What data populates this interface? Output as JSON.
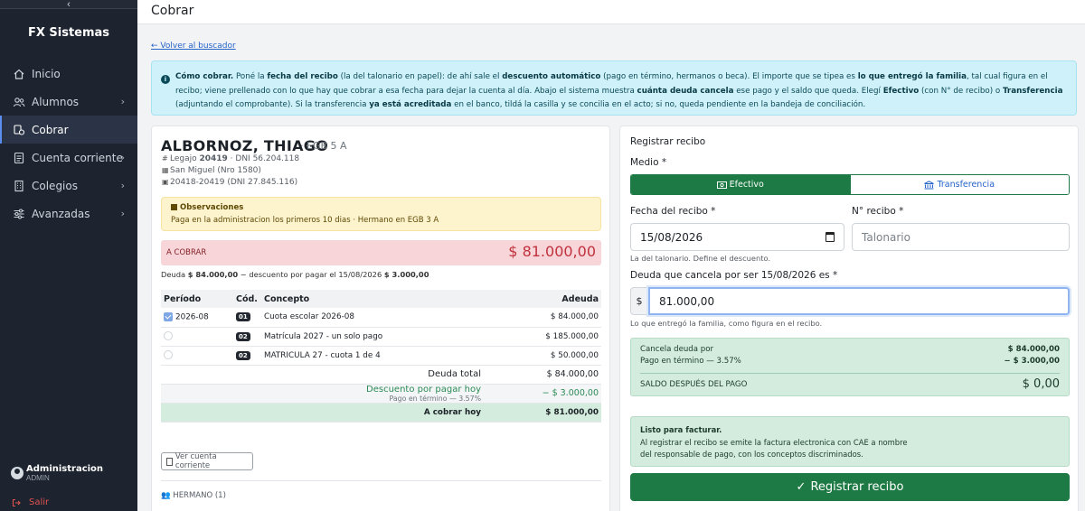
{
  "sidebar": {
    "collapse_glyph": "‹",
    "brand": "FX Sistemas",
    "items": [
      {
        "label": "Inicio"
      },
      {
        "label": "Alumnos"
      },
      {
        "label": "Cobrar"
      },
      {
        "label": "Cuenta corriente"
      },
      {
        "label": "Colegios"
      },
      {
        "label": "Avanzadas"
      }
    ],
    "user": {
      "name": "Administracion",
      "role": "ADMIN"
    },
    "logout": "Salir"
  },
  "topbar": {
    "title": "Cobrar"
  },
  "back_link": "← Volver al buscador",
  "info": {
    "p1": "Cómo cobrar.",
    "p2": " Poné la ",
    "p3": "fecha del recibo",
    "p4": " (la del talonario en papel): de ahí sale el ",
    "p5": "descuento automático",
    "p6": " (pago en término, hermanos o beca). El importe que se tipea es ",
    "p7": "lo que entregó la familia",
    "p8": ", tal cual figura en el recibo; viene prellenado con lo que hay que cobrar a esa fecha para dejar la cuenta al día. Abajo el sistema muestra ",
    "p9": "cuánta deuda cancela",
    "p10": " ese pago y el saldo que queda. Elegí ",
    "p11": "Efectivo",
    "p12": " (con N° de recibo) o ",
    "p13": "Transferencia",
    "p14": " (adjuntando el comprobante). Si la transferencia ",
    "p15": "ya está acreditada",
    "p16": " en el banco, tildá la casilla y se concilia en el acto; si no, queda pendiente en la bandeja de conciliación."
  },
  "student": {
    "name": "ALBORNOZ, THIAGO",
    "grade": "· EGB 5 A",
    "legajo_prefix": "Legajo ",
    "legajo": "20419",
    "dni": " · DNI 56.204.118",
    "school": "San Miguel (Nro 1580)",
    "family": "20418-20419 (DNI 27.845.116)"
  },
  "observaciones": {
    "title": "Observaciones",
    "text": "Paga en la administracion los primeros 10 dias · Hermano en EGB 3 A"
  },
  "a_cobrar": {
    "label": "A COBRAR",
    "value": "$ 81.000,00"
  },
  "deuda_line": {
    "pre": "Deuda ",
    "deuda": "$ 84.000,00",
    "mid": " − descuento por pagar el 15/08/2026 ",
    "desc": "$ 3.000,00"
  },
  "table": {
    "headers": {
      "periodo": "Período",
      "cod": "Cód.",
      "concepto": "Concepto",
      "adeuda": "Adeuda"
    },
    "rows": [
      {
        "periodo": "2026-08",
        "cod": "01",
        "concepto": "Cuota escolar 2026-08",
        "adeuda": "$ 84.000,00"
      },
      {
        "periodo": "",
        "cod": "02",
        "concepto": "Matrícula 2027 - un solo pago",
        "adeuda": "$ 185.000,00"
      },
      {
        "periodo": "",
        "cod": "02",
        "concepto": "MATRICULA 27 - cuota 1 de 4",
        "adeuda": "$ 50.000,00"
      }
    ],
    "deuda_total_label": "Deuda total",
    "deuda_total_value": "$ 84.000,00",
    "descuento_label": "Descuento por pagar hoy",
    "descuento_sub": "Pago en término — 3.57%",
    "descuento_value": "− $ 3.000,00",
    "a_cobrar_hoy_label": "A cobrar hoy",
    "a_cobrar_hoy_value": "$ 81.000,00"
  },
  "ver_cuenta_btn": "Ver cuenta corriente",
  "hermano": "HERMANO (1)",
  "form": {
    "title": "Registrar recibo",
    "medio_label": "Medio *",
    "medio_efectivo": "Efectivo",
    "medio_transferencia": "Transferencia",
    "fecha_label": "Fecha del recibo *",
    "fecha_value": "15/08/2026",
    "fecha_help": "La del talonario. Define el descuento.",
    "nro_label": "N° recibo *",
    "nro_placeholder": "Talonario",
    "deuda_label": "Deuda que cancela por ser 15/08/2026 es *",
    "currency": "$",
    "amount": "81.000,00",
    "amount_help": "Lo que entregó la familia, como figura en el recibo.",
    "calc": {
      "cancela_label": "Cancela deuda por",
      "cancela_value": "$ 84.000,00",
      "pago_label": "Pago en término — 3.57%",
      "pago_value": "− $ 3.000,00",
      "saldo_label": "SALDO DESPUÉS DEL PAGO",
      "saldo_value": "$ 0,00"
    },
    "ready_title": "Listo para facturar.",
    "ready_text1": "Al registrar el recibo se emite la factura electronica con CAE a nombre",
    "ready_text2": "del responsable de pago, con los conceptos discriminados.",
    "submit": "Registrar recibo"
  }
}
